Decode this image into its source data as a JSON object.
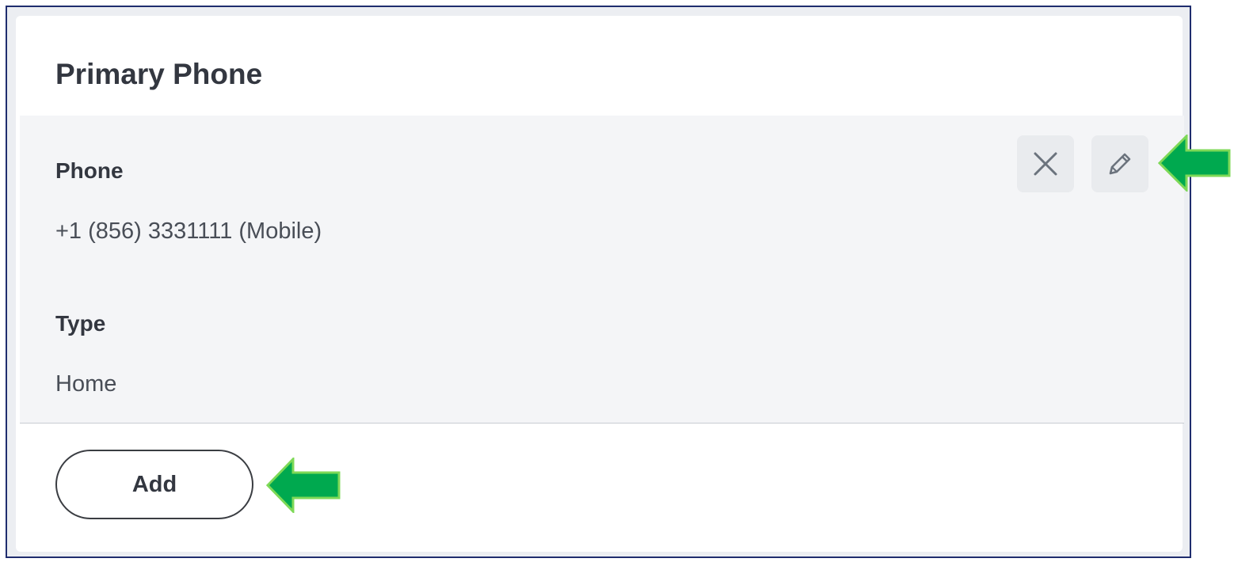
{
  "card": {
    "title": "Primary Phone"
  },
  "phone_entry": {
    "phone_label": "Phone",
    "phone_value": "+1 (856) 3331111 (Mobile)",
    "type_label": "Type",
    "type_value": "Home"
  },
  "actions": {
    "delete_icon": "close-icon",
    "edit_icon": "pencil-icon",
    "add_label": "Add"
  },
  "annotations": {
    "arrow_color": "#00a94f",
    "arrow_outline": "#7ed957"
  }
}
